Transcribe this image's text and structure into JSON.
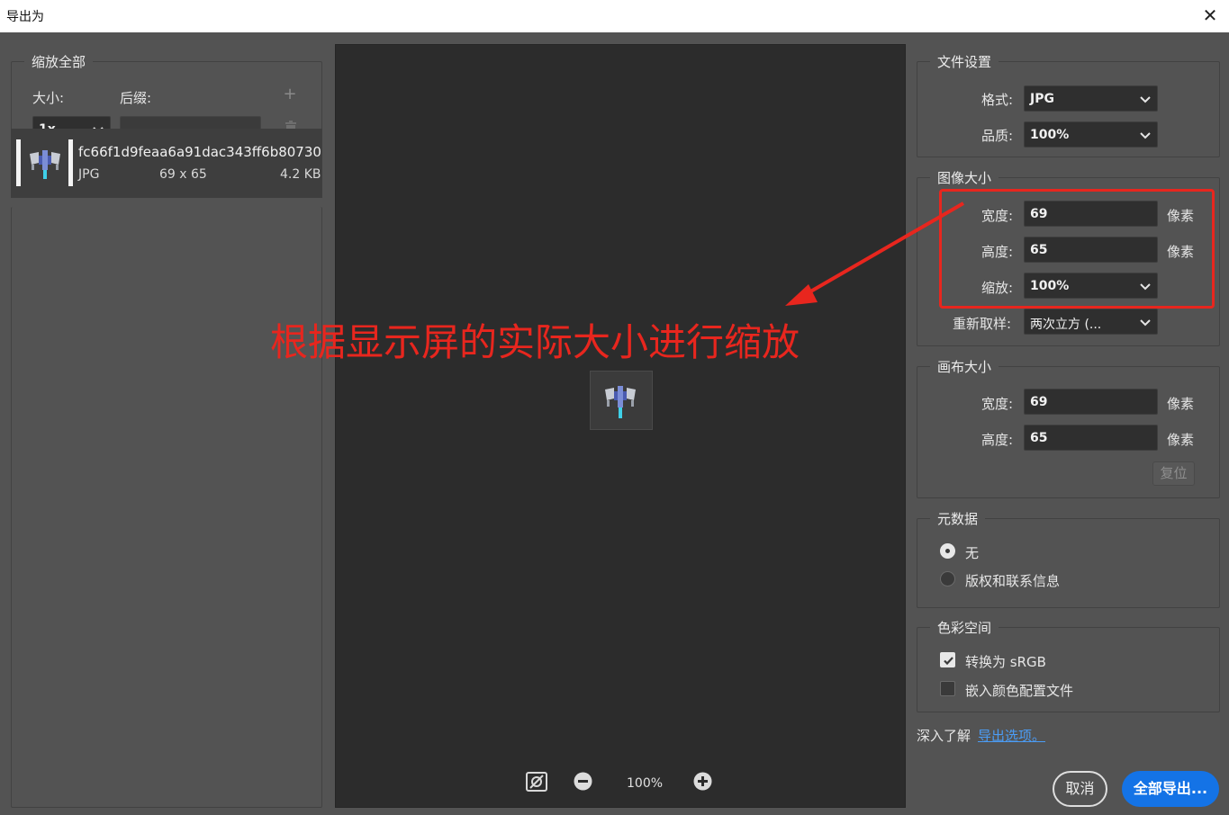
{
  "window": {
    "title": "导出为",
    "close_icon": "close-icon"
  },
  "left": {
    "section_title": "缩放全部",
    "size_label": "大小:",
    "suffix_label": "后缀:",
    "size_value": "1x",
    "suffix_value": "",
    "add_icon": "plus-icon",
    "delete_icon": "trash-icon",
    "file": {
      "name": "fc66f1d9feaa6a91dac343ff6b80730",
      "format": "JPG",
      "dimensions": "69 x 65",
      "size": "4.2 KB"
    }
  },
  "preview": {
    "zoom": "100%",
    "fit_icon": "fit-to-screen-icon",
    "zoom_out_icon": "zoom-out-icon",
    "zoom_in_icon": "zoom-in-icon"
  },
  "annotation": {
    "text": "根据显示屏的实际大小进行缩放",
    "color": "#e8261e"
  },
  "file_settings": {
    "title": "文件设置",
    "format_label": "格式:",
    "format_value": "JPG",
    "quality_label": "品质:",
    "quality_value": "100%"
  },
  "image_size": {
    "title": "图像大小",
    "width_label": "宽度:",
    "width_value": "69",
    "width_unit": "像素",
    "height_label": "高度:",
    "height_value": "65",
    "height_unit": "像素",
    "scale_label": "缩放:",
    "scale_value": "100%",
    "resample_label": "重新取样:",
    "resample_value": "两次立方 (..."
  },
  "canvas_size": {
    "title": "画布大小",
    "width_label": "宽度:",
    "width_value": "69",
    "width_unit": "像素",
    "height_label": "高度:",
    "height_value": "65",
    "height_unit": "像素",
    "reset_label": "复位"
  },
  "metadata": {
    "title": "元数据",
    "option_none": "无",
    "option_copyright": "版权和联系信息",
    "selected": "无"
  },
  "color_space": {
    "title": "色彩空间",
    "convert_srgb": "转换为 sRGB",
    "convert_srgb_checked": true,
    "embed_profile": "嵌入颜色配置文件",
    "embed_profile_checked": false
  },
  "footer": {
    "learn_more": "深入了解",
    "export_options_link": "导出选项。",
    "cancel_label": "取消",
    "export_all_label": "全部导出...",
    "accent_color": "#1473e6"
  }
}
